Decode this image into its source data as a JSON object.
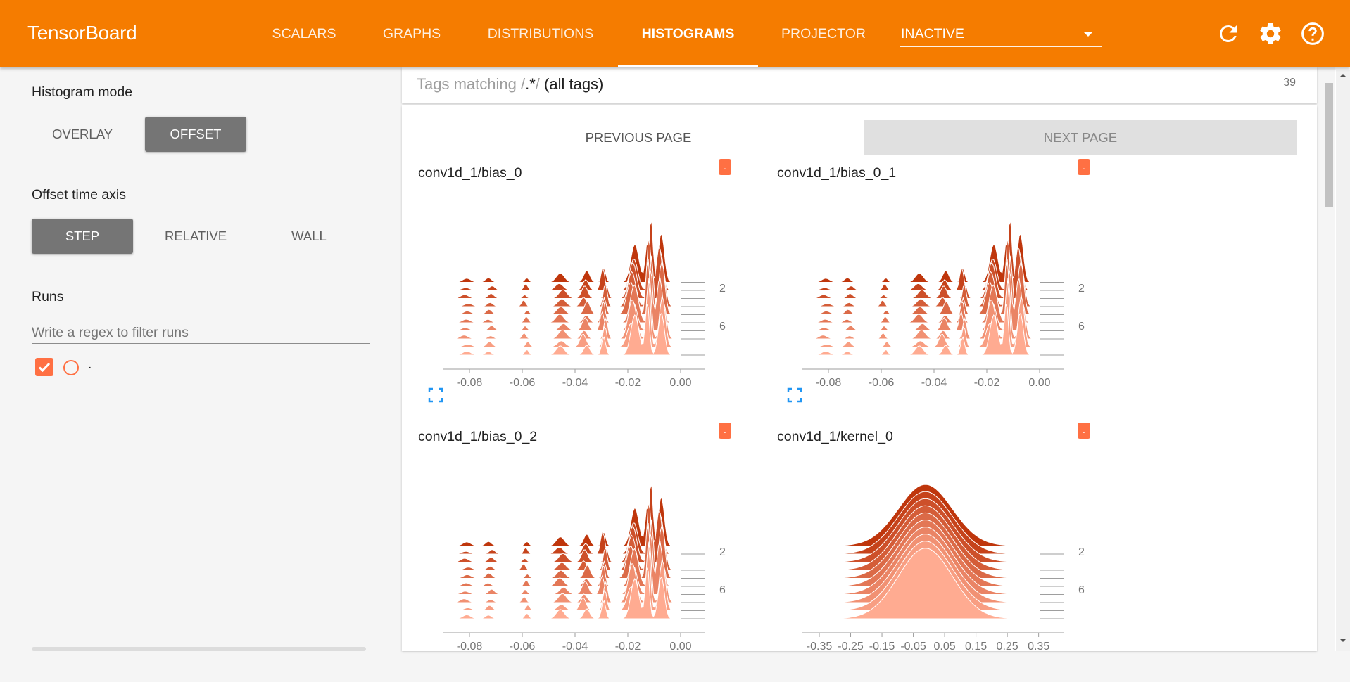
{
  "app": {
    "brand": "TensorBoard"
  },
  "nav": {
    "tabs": [
      {
        "label": "SCALARS"
      },
      {
        "label": "GRAPHS"
      },
      {
        "label": "DISTRIBUTIONS"
      },
      {
        "label": "HISTOGRAMS",
        "active": true
      },
      {
        "label": "PROJECTOR"
      }
    ],
    "inactive_select": "INACTIVE",
    "icons": [
      "refresh-icon",
      "settings-icon",
      "help-icon"
    ]
  },
  "sidebar": {
    "histogram_mode": {
      "title": "Histogram mode",
      "options": [
        "OVERLAY",
        "OFFSET"
      ],
      "selected": "OFFSET"
    },
    "offset_time_axis": {
      "title": "Offset time axis",
      "options": [
        "STEP",
        "RELATIVE",
        "WALL"
      ],
      "selected": "STEP"
    },
    "runs": {
      "title": "Runs",
      "filter_placeholder": "Write a regex to filter runs",
      "items": [
        {
          "label": ".",
          "checked": true
        }
      ]
    }
  },
  "tags": {
    "prefix": "Tags matching /",
    "regex": ".*",
    "suffix": "/",
    "all_tags": "(all tags)",
    "count": "39"
  },
  "pagination": {
    "prev": "PREVIOUS PAGE",
    "next": "NEXT PAGE"
  },
  "colors": {
    "accent": "#f57c00",
    "hist_dark": "#bf360c",
    "hist_light": "#ffab91"
  },
  "charts": [
    {
      "title": "conv1d_1/bias_0",
      "x_ticks": [
        "-0.08",
        "-0.06",
        "-0.04",
        "-0.02",
        "0.00"
      ],
      "y_ticks": [
        "2",
        "6"
      ],
      "chart_data": {
        "type": "area",
        "kind": "offset-histogram",
        "xlim": [
          -0.09,
          0.0
        ],
        "y_ticks": [
          2,
          6
        ]
      }
    },
    {
      "title": "conv1d_1/bias_0_1",
      "x_ticks": [
        "-0.08",
        "-0.06",
        "-0.04",
        "-0.02",
        "0.00"
      ],
      "y_ticks": [
        "2",
        "6"
      ],
      "chart_data": {
        "type": "area",
        "kind": "offset-histogram",
        "xlim": [
          -0.09,
          0.0
        ],
        "y_ticks": [
          2,
          6
        ]
      }
    },
    {
      "title": "conv1d_1/bias_0_2",
      "x_ticks": [
        "-0.08",
        "-0.06",
        "-0.04",
        "-0.02",
        "0.00"
      ],
      "y_ticks": [
        "2",
        "6"
      ],
      "chart_data": {
        "type": "area",
        "kind": "offset-histogram",
        "xlim": [
          -0.09,
          0.0
        ],
        "y_ticks": [
          2,
          6
        ]
      }
    },
    {
      "title": "conv1d_1/kernel_0",
      "x_ticks": [
        "-0.35",
        "-0.25",
        "-0.15",
        "-0.05",
        "0.05",
        "0.15",
        "0.25",
        "0.35"
      ],
      "y_ticks": [
        "2",
        "6"
      ],
      "chart_data": {
        "type": "area",
        "kind": "offset-histogram",
        "xlim": [
          -0.38,
          0.38
        ],
        "y_ticks": [
          2,
          6
        ]
      }
    }
  ]
}
